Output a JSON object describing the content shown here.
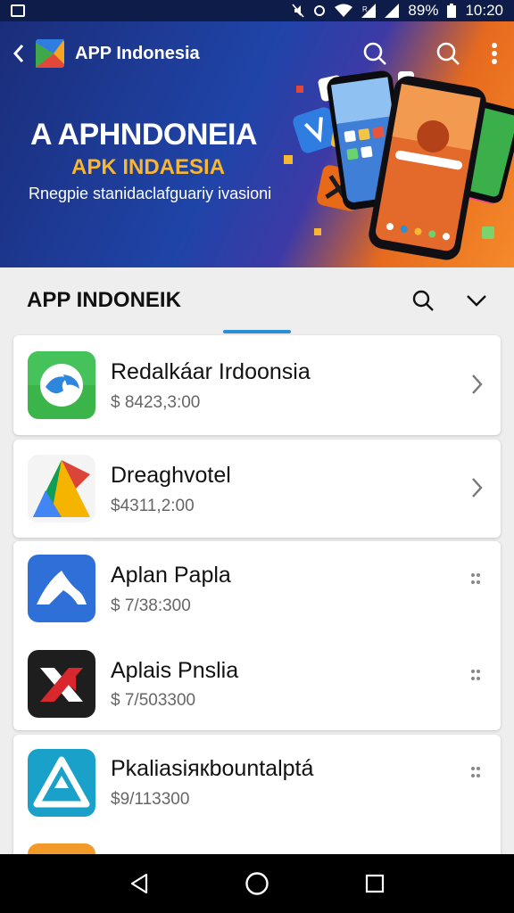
{
  "status_bar": {
    "battery": "89%",
    "time": "10:20"
  },
  "header": {
    "app_title": "APP Indonesia"
  },
  "hero": {
    "headline": "A APHNDONEIA",
    "subheadline": "APK INDAESIA",
    "tagline": "Rnegpie stanidaclafguariy ivasioni"
  },
  "section": {
    "title": "APP INDONEIK"
  },
  "apps": [
    {
      "name": "Redalkáar Irdoonsia",
      "price": "$ 8423,3:00",
      "icon": "globe-app-icon",
      "action": "chevron"
    },
    {
      "name": "Dreaghvotel",
      "price": "$4311,2:00",
      "icon": "triangle-app-icon",
      "action": "chevron"
    },
    {
      "name": "Aplan Papla",
      "price": "$ 7/38:300",
      "icon": "wave-app-icon",
      "action": "drag"
    },
    {
      "name": "Aplais Pnslia",
      "price": "$ 7/503300",
      "icon": "x-app-icon",
      "action": "drag"
    },
    {
      "name": "Pkaliasiякbountalptá",
      "price": "$9/113300",
      "icon": "delta-app-icon",
      "action": "drag"
    }
  ],
  "colors": {
    "accent": "#2a8fd6",
    "banner_blue": "#1f44a8",
    "banner_orange": "#f58a2a",
    "highlight_yellow": "#f7b733"
  }
}
